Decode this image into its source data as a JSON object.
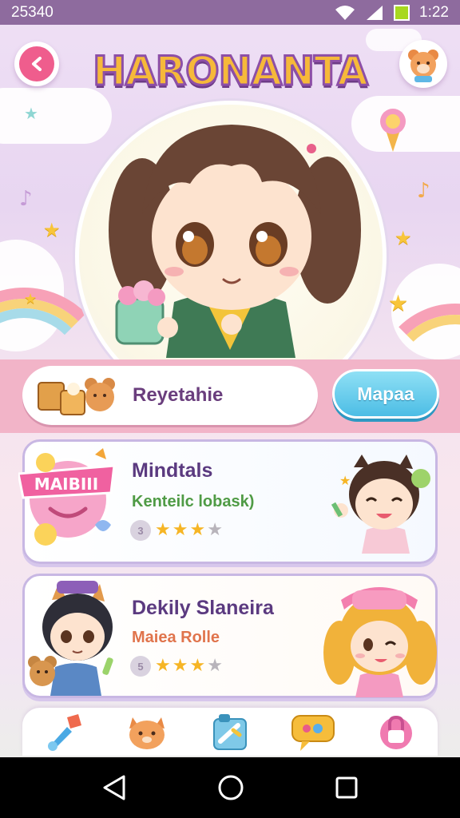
{
  "status_bar": {
    "time_left": "25340",
    "time_right": "1:22"
  },
  "header": {
    "title": "HARONANTA"
  },
  "search": {
    "label": "Reyetahie",
    "action_label": "Mapaa"
  },
  "cards": [
    {
      "title": "Mindtals",
      "subtitle": "Kenteilc lobask)",
      "rating_number": "3",
      "stars_on": 3,
      "stars_total": 4,
      "badge_text": "MAIBIII",
      "subtitle_color": "#4f9b45"
    },
    {
      "title": "Dekily Slaneira",
      "subtitle": "Maiea Rolle",
      "rating_number": "5",
      "stars_on": 3,
      "stars_total": 4,
      "subtitle_color": "#e0744c"
    }
  ],
  "nav": {
    "items": [
      {
        "icon": "paintbrush-icon"
      },
      {
        "icon": "bear-icon"
      },
      {
        "icon": "roller-icon"
      },
      {
        "icon": "chat-bubble-icon"
      },
      {
        "icon": "lock-icon"
      }
    ]
  },
  "colors": {
    "accent": "#ef5d8d",
    "title_fill": "#f6b93a",
    "title_stroke": "#8d4fa7",
    "action_button": "#4cbde5",
    "card_border": "#c8b7e3"
  }
}
